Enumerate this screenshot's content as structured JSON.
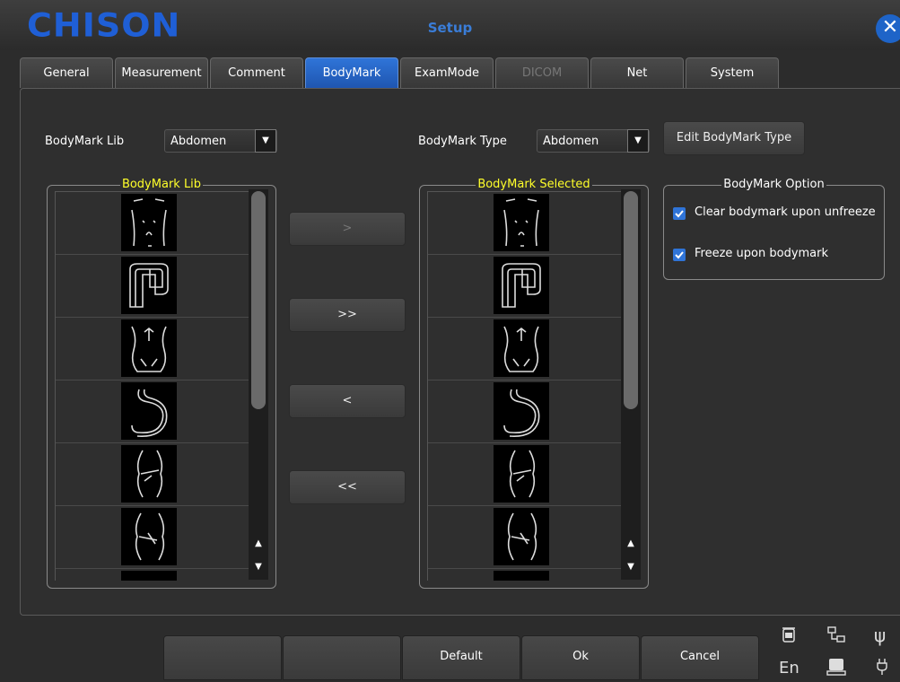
{
  "window": {
    "brand": "CHISON",
    "title": "Setup",
    "close": "✕"
  },
  "tabs": [
    {
      "label": "General",
      "state": "normal"
    },
    {
      "label": "Measurement",
      "state": "normal"
    },
    {
      "label": "Comment",
      "state": "normal"
    },
    {
      "label": "BodyMark",
      "state": "active"
    },
    {
      "label": "ExamMode",
      "state": "normal"
    },
    {
      "label": "DICOM",
      "state": "disabled"
    },
    {
      "label": "Net",
      "state": "normal"
    },
    {
      "label": "System",
      "state": "normal"
    }
  ],
  "lib": {
    "label": "BodyMark Lib",
    "value": "Abdomen",
    "arrow": "▼",
    "group_title": "BodyMark Lib"
  },
  "type": {
    "label": "BodyMark Type",
    "value": "Abdomen",
    "arrow": "▼",
    "edit_button": "Edit BodyMark Type"
  },
  "selected": {
    "group_title": "BodyMark Selected"
  },
  "transfer": {
    "add": ">",
    "add_all": ">>",
    "remove": "<",
    "remove_all": "<<"
  },
  "bodymark_icons": [
    "abdomen-front-icon",
    "colon-icon",
    "torso-back-icon",
    "stomach-icon",
    "kidney-left-icon",
    "kidney-right-icon",
    "breast-icon"
  ],
  "scroll": {
    "up": "▲",
    "down": "▼"
  },
  "options": {
    "title": "BodyMark Option",
    "items": [
      {
        "label": "Clear bodymark upon unfreeze",
        "checked": true
      },
      {
        "label": "Freeze upon bodymark",
        "checked": true
      }
    ]
  },
  "footer": {
    "buttons": [
      "",
      "",
      "Default",
      "Ok",
      "Cancel"
    ],
    "lang": "En"
  },
  "colors": {
    "accent": "#1f5fd6",
    "legend": "#ffff2a"
  }
}
